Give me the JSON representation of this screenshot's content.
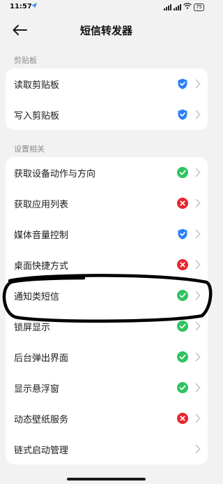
{
  "status_bar": {
    "time": "11:57",
    "battery": "75"
  },
  "header": {
    "title": "短信转发器"
  },
  "sections": [
    {
      "label": "剪贴板",
      "items": [
        {
          "label": "读取剪贴板",
          "status": "shield"
        },
        {
          "label": "写入剪贴板",
          "status": "shield"
        }
      ]
    },
    {
      "label": "设置相关",
      "items": [
        {
          "label": "获取设备动作与方向",
          "status": "granted"
        },
        {
          "label": "获取应用列表",
          "status": "denied"
        },
        {
          "label": "媒体音量控制",
          "status": "shield"
        },
        {
          "label": "桌面快捷方式",
          "status": "denied"
        },
        {
          "label": "通知类短信",
          "status": "granted"
        },
        {
          "label": "锁屏显示",
          "status": "granted"
        },
        {
          "label": "后台弹出界面",
          "status": "granted"
        },
        {
          "label": "显示悬浮窗",
          "status": "granted"
        },
        {
          "label": "动态壁纸服务",
          "status": "denied"
        },
        {
          "label": "链式启动管理",
          "status": "none"
        }
      ]
    }
  ],
  "colors": {
    "granted": "#2fc45f",
    "denied": "#e8262e",
    "shield": "#2d7ff9",
    "chevron": "#c4c4c4",
    "annotation": "#000000"
  }
}
